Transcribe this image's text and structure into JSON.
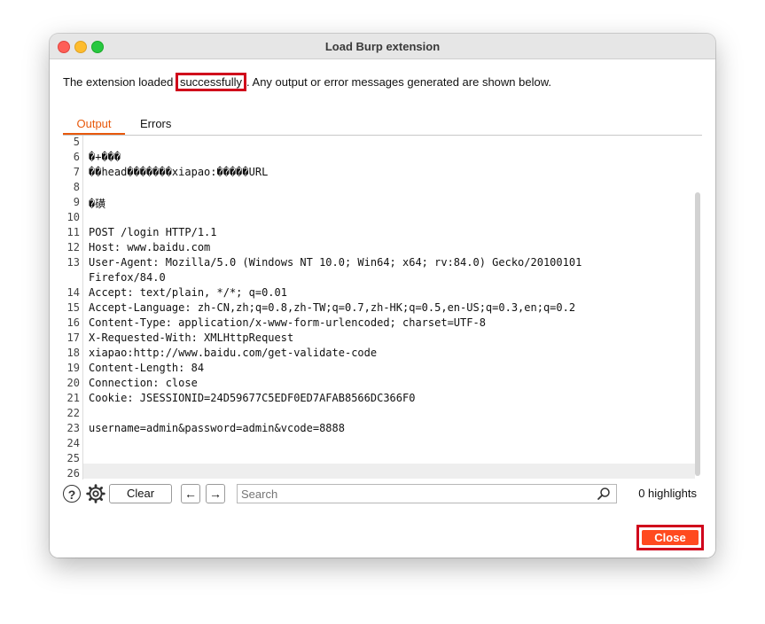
{
  "window": {
    "title": "Load Burp extension"
  },
  "message": {
    "before": "The extension loaded ",
    "highlight": "successfully",
    "after": ". Any output or error messages generated are shown below."
  },
  "tabs": [
    {
      "label": "Output",
      "active": true
    },
    {
      "label": "Errors",
      "active": false
    }
  ],
  "lines": [
    {
      "n": "5",
      "text": ""
    },
    {
      "n": "6",
      "text": "�+���"
    },
    {
      "n": "7",
      "text": "��head�������xiapao:�����URL"
    },
    {
      "n": "8",
      "text": ""
    },
    {
      "n": "9",
      "text": "�磺"
    },
    {
      "n": "10",
      "text": ""
    },
    {
      "n": "11",
      "text": "POST /login HTTP/1.1"
    },
    {
      "n": "12",
      "text": "Host: www.baidu.com"
    },
    {
      "n": "13",
      "text": "User-Agent: Mozilla/5.0 (Windows NT 10.0; Win64; x64; rv:84.0) Gecko/20100101"
    },
    {
      "n": "",
      "text": "Firefox/84.0"
    },
    {
      "n": "14",
      "text": "Accept: text/plain, */*; q=0.01"
    },
    {
      "n": "15",
      "text": "Accept-Language: zh-CN,zh;q=0.8,zh-TW;q=0.7,zh-HK;q=0.5,en-US;q=0.3,en;q=0.2"
    },
    {
      "n": "16",
      "text": "Content-Type: application/x-www-form-urlencoded; charset=UTF-8"
    },
    {
      "n": "17",
      "text": "X-Requested-With: XMLHttpRequest"
    },
    {
      "n": "18",
      "text": "xiapao:http://www.baidu.com/get-validate-code"
    },
    {
      "n": "19",
      "text": "Content-Length: 84"
    },
    {
      "n": "20",
      "text": "Connection: close"
    },
    {
      "n": "21",
      "text": "Cookie: JSESSIONID=24D59677C5EDF0ED7AFAB8566DC366F0"
    },
    {
      "n": "22",
      "text": ""
    },
    {
      "n": "23",
      "text": "username=admin&password=admin&vcode=8888"
    },
    {
      "n": "24",
      "text": ""
    },
    {
      "n": "25",
      "text": ""
    },
    {
      "n": "26",
      "text": ""
    }
  ],
  "toolbar": {
    "help_glyph": "?",
    "clear_label": "Clear",
    "back_glyph": "←",
    "forward_glyph": "→",
    "search_placeholder": "Search",
    "highlights": "0 highlights"
  },
  "footer": {
    "close_label": "Close"
  },
  "colors": {
    "accent": "#e8590c",
    "close_button": "#ff4a1f",
    "annotation": "#d0021b"
  }
}
